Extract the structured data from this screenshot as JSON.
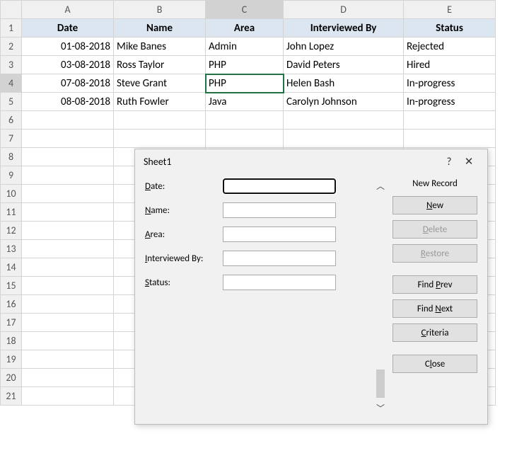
{
  "columns": [
    "A",
    "B",
    "C",
    "D",
    "E"
  ],
  "rowCount": 21,
  "selectedCol": "C",
  "selectedRow": 4,
  "selectedCell": {
    "row": 4,
    "col": "C"
  },
  "headers": {
    "A": "Date",
    "B": "Name",
    "C": "Area",
    "D": "Interviewed By",
    "E": "Status"
  },
  "rows": [
    {
      "A": "01-08-2018",
      "B": "Mike Banes",
      "C": "Admin",
      "D": "John Lopez",
      "E": "Rejected"
    },
    {
      "A": "03-08-2018",
      "B": "Ross Taylor",
      "C": "PHP",
      "D": "David Peters",
      "E": "Hired"
    },
    {
      "A": "07-08-2018",
      "B": "Steve Grant",
      "C": "PHP",
      "D": "Helen Bash",
      "E": "In-progress"
    },
    {
      "A": "08-08-2018",
      "B": "Ruth Fowler",
      "C": "Java",
      "D": "Carolyn Johnson",
      "E": "In-progress"
    }
  ],
  "dialog": {
    "title": "Sheet1",
    "recordLabel": "New Record",
    "fields": [
      {
        "label": "Date:",
        "accel": "D",
        "value": ""
      },
      {
        "label": "Name:",
        "accel": "N",
        "value": ""
      },
      {
        "label": "Area:",
        "accel": "A",
        "value": ""
      },
      {
        "label": "Interviewed By:",
        "accel": "I",
        "value": ""
      },
      {
        "label": "Status:",
        "accel": "S",
        "value": ""
      }
    ],
    "buttons": {
      "new": "New",
      "delete": "Delete",
      "restore": "Restore",
      "findPrev": "Find Prev",
      "findNext": "Find Next",
      "criteria": "Criteria",
      "close": "Close"
    }
  }
}
